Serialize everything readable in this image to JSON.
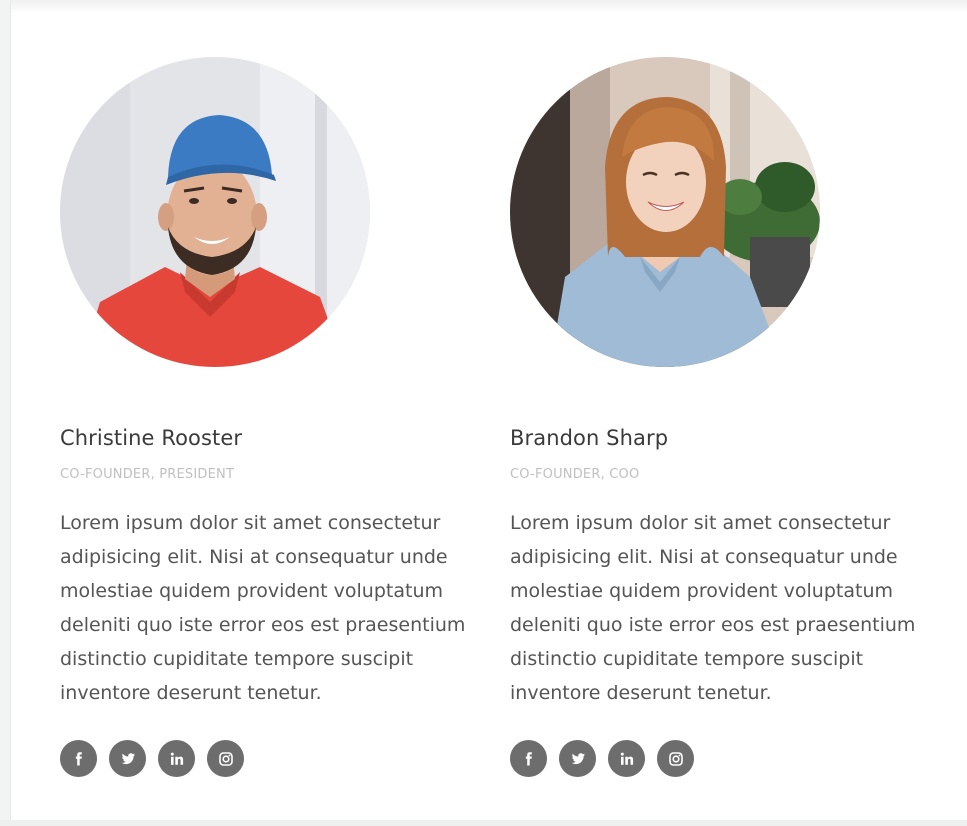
{
  "members": [
    {
      "name": "Christine Rooster",
      "role": "CO-FOUNDER, PRESIDENT",
      "bio": "Lorem ipsum dolor sit amet consectetur adipisicing elit. Nisi at consequatur unde molestiae quidem provident voluptatum deleniti quo iste error eos est praesentium distinctio cupiditate tempore suscipit inventore deserunt tenetur."
    },
    {
      "name": "Brandon Sharp",
      "role": "CO-FOUNDER, COO",
      "bio": "Lorem ipsum dolor sit amet consectetur adipisicing elit. Nisi at consequatur unde molestiae quidem provident voluptatum deleniti quo iste error eos est praesentium distinctio cupiditate tempore suscipit inventore deserunt tenetur."
    }
  ],
  "social_icons": [
    "facebook-icon",
    "twitter-icon",
    "linkedin-icon",
    "instagram-icon"
  ],
  "colors": {
    "name_text": "#3a3a3a",
    "role_text": "#c0c0c0",
    "bio_text": "#555555",
    "social_bg": "#6d6d6d"
  }
}
